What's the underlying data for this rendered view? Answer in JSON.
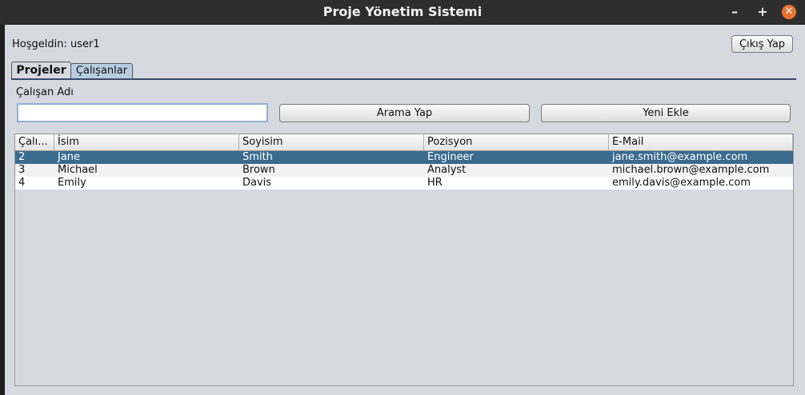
{
  "window": {
    "title": "Proje Yönetim Sistemi",
    "min_glyph": "–",
    "max_glyph": "+",
    "close_glyph": "✕"
  },
  "header": {
    "welcome": "Hoşgeldin: user1",
    "logout_label": "Çıkış Yap"
  },
  "tabs": [
    {
      "label": "Projeler",
      "selected": true
    },
    {
      "label": "Çalışanlar",
      "selected": false
    }
  ],
  "search": {
    "label": "Çalışan Adı",
    "value": "",
    "search_button": "Arama Yap",
    "add_button": "Yeni Ekle"
  },
  "table": {
    "columns": [
      "Çalı...",
      "İsim",
      "Soyisim",
      "Pozisyon",
      "E-Mail"
    ],
    "rows": [
      {
        "id": "2",
        "name": "Jane",
        "surname": "Smith",
        "position": "Engineer",
        "email": "jane.smith@example.com",
        "selected": true
      },
      {
        "id": "3",
        "name": "Michael",
        "surname": "Brown",
        "position": "Analyst",
        "email": "michael.brown@example.com",
        "selected": false
      },
      {
        "id": "4",
        "name": "Emily",
        "surname": "Davis",
        "position": "HR",
        "email": "emily.davis@example.com",
        "selected": false
      }
    ]
  },
  "colors": {
    "selection": "#3a6b8f",
    "close_button": "#e9722f",
    "window_bg": "#d6d9df"
  }
}
